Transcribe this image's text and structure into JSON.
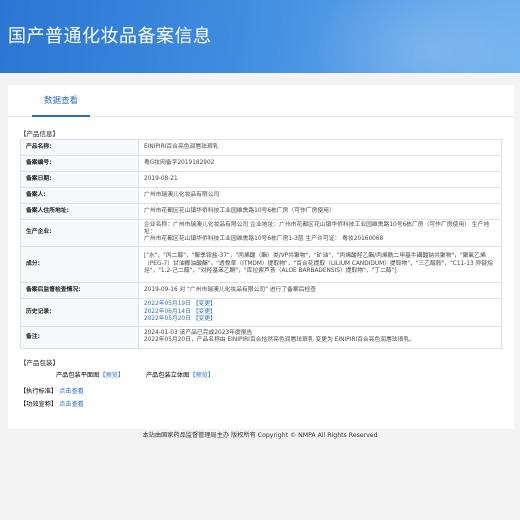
{
  "header": {
    "title": "国产普通化妆品备案信息"
  },
  "tabs": [
    {
      "label": "数据查看"
    }
  ],
  "sections": {
    "product_info": "【产品信息】",
    "packaging": "【产品包装】",
    "standard": "【执行标准】",
    "efficacy": "【功效宣称】"
  },
  "product": {
    "rows": [
      {
        "label": "产品名称:",
        "value": "EINIPIRI百合亮色润唇珐琅乳"
      },
      {
        "label": "备案编号:",
        "value": "粤G妆网备字2019182902"
      },
      {
        "label": "备案日期:",
        "value": "2019-08-21"
      },
      {
        "label": "备案人:",
        "value": "广州市瑞澳儿化妆品有限公司"
      },
      {
        "label": "备案人住所地址:",
        "value": "广州市花都区花山镇华侨科技工业园维熏路10号6栋厂房（可作厂房使用）"
      },
      {
        "label": "生产企业:",
        "lines": [
          "企业名称：广州市瑞澳儿化妆品有限公司 企业地址：广州市花都区花山镇华侨科技工业园维熏路10号6栋厂房（可作厂房使用） 生产地址：",
          "广州市花都区花山镇华侨科技工业园维熏路10号6栋厂房1-3层 生产许可证： 粤妆20160068"
        ]
      },
      {
        "label": "成分:",
        "lines": [
          "[\"水\"，\"丙二醇\"，\"聚季铵盐-37\"，\"丙烯酸（酯）类/VP共聚物\"，\"矿油\"，\"丙烯酸羟乙酯/丙烯酰二甲基牛磺酸钠共聚物\"，\"聚氧乙烯",
          "（PEG-7）甘油椰油酸酯\"，\"透骨草（ITMDM）提取物\"，\"百合花提取（LILIUM CANDIDUM）提取物\"，\"三乙醇胺\"，\"C11-13 异链烷",
          "烃\"，\"1,2-己二醇\"，\"对羟基苯乙酮\"，\"库拉索芦荟（ALOE BARBADENSIS）提取物\"，\"丁二醇\"]"
        ]
      },
      {
        "label": "备案后监督检查情况:",
        "value": "2019-09-16 对 \"广州市瑞澳儿化妆品有限公司\" 进行了备案后检查"
      },
      {
        "label": "历史记录:",
        "lines": [
          "2022年05月19日 【变更】",
          "2022年06月14日 【变更】",
          "2022年05月20日 【变更】"
        ]
      },
      {
        "label": "备注:",
        "lines": [
          "2024-01-03 该产品已完成2023年度报告",
          "2022年05月20日，产品名称由 EINIPIRI百合恰然亮色润唇珐琅乳 变更为 EINIPIRI百合亮色润唇珐琅乳。"
        ]
      }
    ]
  },
  "packaging": {
    "plan_label": "产品包装平面图",
    "plan_preview": "【预览】",
    "solid_label": "产品包装立体图",
    "solid_preview": "【预览】"
  },
  "standard": {
    "link": "点击查看"
  },
  "efficacy": {
    "link": "点击查看"
  },
  "footer": {
    "text": "本站由国家药品监督管理局主办 版权所有 Copyright © NMPA All Rights Reserved"
  }
}
